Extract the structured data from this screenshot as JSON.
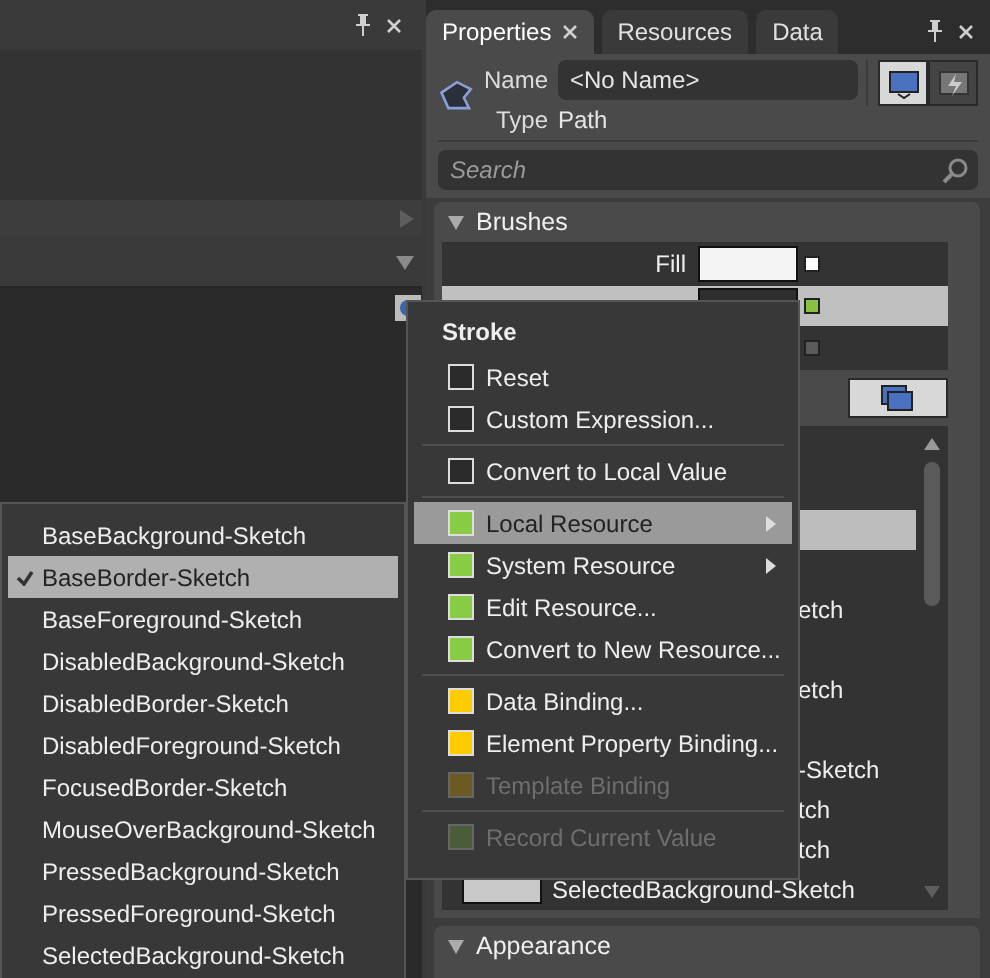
{
  "properties_panel": {
    "tabs": [
      {
        "label": "Properties",
        "selected": true,
        "closable": true
      },
      {
        "label": "Resources",
        "selected": false,
        "closable": false
      },
      {
        "label": "Data",
        "selected": false,
        "closable": false
      }
    ],
    "name_label": "Name",
    "name_value": "<No Name>",
    "type_label": "Type",
    "type_value": "Path",
    "search": {
      "placeholder": "Search"
    },
    "sections": [
      {
        "title": "Brushes",
        "expanded": true
      },
      {
        "title": "Appearance",
        "expanded": true
      }
    ],
    "brushes": [
      {
        "label": "Fill",
        "selected": false,
        "kind": "light",
        "color": "#ffffff"
      },
      {
        "selected": true,
        "kind": "dark",
        "color": "#88c040"
      },
      {
        "selected": false,
        "color": "#5a5a5a"
      }
    ],
    "resource_rows": [
      {
        "selected": true
      },
      {
        "label": "etch",
        "selected": false
      },
      {
        "label": "etch",
        "selected": false
      },
      {
        "label": "-Sketch",
        "selected": false
      },
      {
        "label": "tch",
        "selected": false
      },
      {
        "label": "tch",
        "selected": false
      },
      {
        "label": "SelectedBackground-Sketch",
        "selected": false,
        "kind": "swatch"
      }
    ]
  },
  "context_menu": {
    "title": "Stroke",
    "groups": [
      [
        {
          "label": "Reset",
          "color": "#2b2b2b",
          "disabled": false,
          "selected": false,
          "submenu": false
        },
        {
          "label": "Custom Expression...",
          "color": "#2b2b2b",
          "disabled": false,
          "selected": false,
          "submenu": false
        }
      ],
      [
        {
          "label": "Convert to Local Value",
          "color": "#2b2b2b",
          "disabled": false,
          "selected": false,
          "submenu": false
        }
      ],
      [
        {
          "label": "Local Resource",
          "color": "#88cc44",
          "disabled": false,
          "selected": true,
          "submenu": true
        },
        {
          "label": "System Resource",
          "color": "#88cc44",
          "disabled": false,
          "selected": false,
          "submenu": true
        },
        {
          "label": "Edit Resource...",
          "color": "#88cc44",
          "disabled": false,
          "selected": false,
          "submenu": false
        },
        {
          "label": "Convert to New Resource...",
          "color": "#88cc44",
          "disabled": false,
          "selected": false,
          "submenu": false
        }
      ],
      [
        {
          "label": "Data Binding...",
          "color": "#ffcc00",
          "disabled": false,
          "selected": false,
          "submenu": false
        },
        {
          "label": "Element Property Binding...",
          "color": "#ffcc00",
          "disabled": false,
          "selected": false,
          "submenu": false
        },
        {
          "label": "Template Binding",
          "color": "#6b5a22",
          "disabled": true,
          "selected": false,
          "submenu": false
        }
      ],
      [
        {
          "label": "Record Current Value",
          "color": "#4b5c38",
          "disabled": true,
          "selected": false,
          "submenu": false
        }
      ]
    ]
  },
  "resource_submenu": {
    "items": [
      {
        "label": "BaseBackground-Sketch",
        "selected": false
      },
      {
        "label": "BaseBorder-Sketch",
        "selected": true
      },
      {
        "label": "BaseForeground-Sketch",
        "selected": false
      },
      {
        "label": "DisabledBackground-Sketch",
        "selected": false
      },
      {
        "label": "DisabledBorder-Sketch",
        "selected": false
      },
      {
        "label": "DisabledForeground-Sketch",
        "selected": false
      },
      {
        "label": "FocusedBorder-Sketch",
        "selected": false
      },
      {
        "label": "MouseOverBackground-Sketch",
        "selected": false
      },
      {
        "label": "PressedBackground-Sketch",
        "selected": false
      },
      {
        "label": "PressedForeground-Sketch",
        "selected": false
      },
      {
        "label": "SelectedBackground-Sketch",
        "selected": false
      }
    ]
  }
}
